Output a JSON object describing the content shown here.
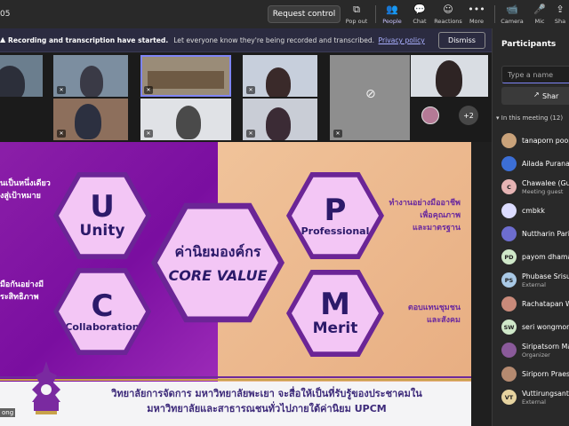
{
  "toolbar": {
    "meeting_time": "05",
    "request_control": "Request control",
    "pop_out": "Pop out",
    "people": "People",
    "chat": "Chat",
    "reactions": "Reactions",
    "more": "More",
    "camera": "Camera",
    "mic": "Mic",
    "share": "Sha"
  },
  "banner": {
    "title": "Recording and transcription have started.",
    "message": "Let everyone know they're being recorded and transcribed.",
    "link": "Privacy policy",
    "dismiss": "Dismiss"
  },
  "video": {
    "overflow_count": "+2"
  },
  "slide": {
    "left_top_lines": [
      "นเป็นหนึ่งเดียว",
      "งสู่เป้าหมาย"
    ],
    "left_bottom_lines": [
      "มือกันอย่างมี",
      "ระสิทธิภาพ"
    ],
    "right_top_lines": [
      "ทำงานอย่างมืออาชีพ",
      "เพื่อคุณภาพ",
      "และมาตรฐาน"
    ],
    "right_bottom_lines": [
      "ตอบแทนชุมชน",
      "และสังคม"
    ],
    "hex_u_letter": "U",
    "hex_u_word": "Unity",
    "hex_c_letter": "C",
    "hex_c_word": "Collaboration",
    "hex_p_letter": "P",
    "hex_p_word": "Professional",
    "hex_m_letter": "M",
    "hex_m_word": "Merit",
    "center_thai": "ค่านิยมองค์กร",
    "center_en": "CORE VALUE",
    "footer_line1": "วิทยาลัยการจัดการ มหาวิทยาลัยพะเยา จะสื่อให้เป็นที่รับรู้ของประชาคมใน",
    "footer_line2": "มหาวิทยาลัยและสาธารณชนทั่วไปภายใต้ค่านิยม UPCM",
    "presenter_tag": "ong"
  },
  "participants": {
    "title": "Participants",
    "search_placeholder": "Type a name",
    "share_label": "Shar",
    "section_label": "In this meeting (12)",
    "people": [
      {
        "initials": "",
        "name": "tanaporn poopr",
        "role": "",
        "color": "#c9a27a"
      },
      {
        "initials": "",
        "name": "Ailada Puranas",
        "role": "",
        "color": "#3c6fd6"
      },
      {
        "initials": "C",
        "name": "Chawalee (Gue",
        "role": "Meeting guest",
        "color": "#e6b4b4"
      },
      {
        "initials": "",
        "name": "cmbkk",
        "role": "",
        "color": "#dcdcff"
      },
      {
        "initials": "",
        "name": "Nuttharin Pariw",
        "role": "",
        "color": "#6d6dcf"
      },
      {
        "initials": "PD",
        "name": "payom dhamab",
        "role": "",
        "color": "#cfe8c9"
      },
      {
        "initials": "PS",
        "name": "Phubase Srisun",
        "role": "External",
        "color": "#a9c9e6"
      },
      {
        "initials": "",
        "name": "Rachatapan Wo",
        "role": "",
        "color": "#c98a7a"
      },
      {
        "initials": "SW",
        "name": "seri wongmonth",
        "role": "",
        "color": "#cfe8c9"
      },
      {
        "initials": "",
        "name": "Siripatsorn Maw",
        "role": "Organizer",
        "color": "#8a5a9a"
      },
      {
        "initials": "",
        "name": "Siriporn Praesr",
        "role": "",
        "color": "#b58a70"
      },
      {
        "initials": "VT",
        "name": "Vuttirungsant T",
        "role": "External",
        "color": "#e6d3a0"
      }
    ]
  },
  "colors": {
    "accent": "#7f85f5",
    "slide_purple": "#7a0ea0",
    "slide_peach": "#e8ae82",
    "hex_fill": "#f3c6f5",
    "hex_border": "#6b2596"
  }
}
